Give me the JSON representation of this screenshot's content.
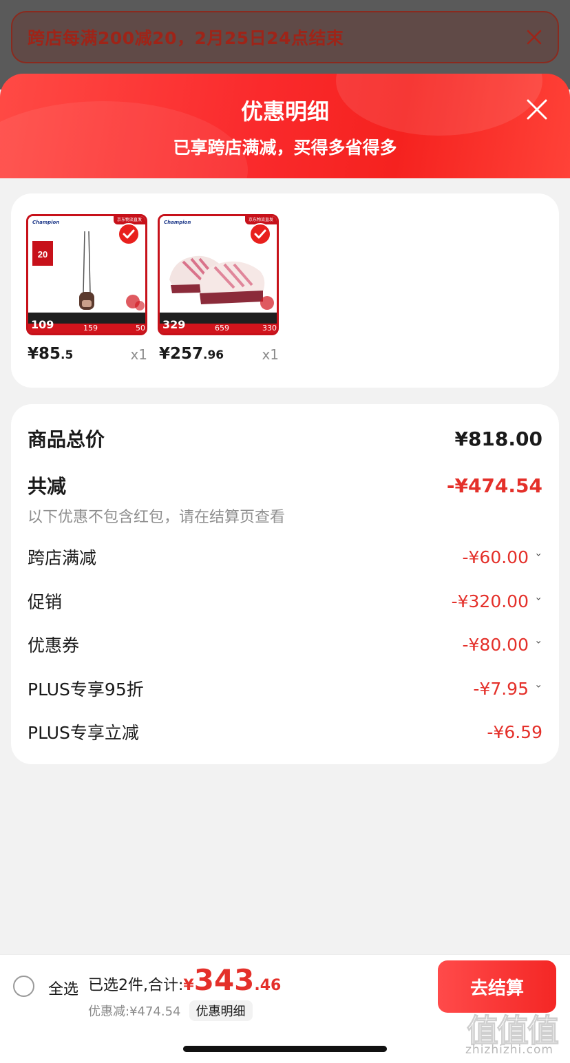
{
  "promo": {
    "text": "跨店每满200减20，2月25日24点结束"
  },
  "sheet": {
    "title": "优惠明细",
    "subtitle": "已享跨店满减，买得多省得多"
  },
  "products": [
    {
      "brand": "Champion",
      "ship_tag": "京东物流直发",
      "promo_price": "109",
      "sub_a": "159",
      "sub_b": "50",
      "price_int": "¥85",
      "price_dec": ".5",
      "qty": "x1"
    },
    {
      "brand": "Champion",
      "ship_tag": "京东物流直发",
      "promo_price": "329",
      "sub_a": "659",
      "sub_b": "330",
      "price_int": "¥257",
      "price_dec": ".96",
      "qty": "x1"
    }
  ],
  "summary": {
    "total_label": "商品总价",
    "total_value": "¥818.00",
    "reduce_label": "共减",
    "reduce_value": "-¥474.54",
    "note": "以下优惠不包含红包，请在结算页查看",
    "items": [
      {
        "label": "跨店满减",
        "value": "-¥60.00",
        "chevron": "›"
      },
      {
        "label": "促销",
        "value": "-¥320.00",
        "chevron": "›"
      },
      {
        "label": "优惠券",
        "value": "-¥80.00",
        "chevron": "›"
      },
      {
        "label": "PLUS专享95折",
        "value": "-¥7.95",
        "chevron": "›"
      },
      {
        "label": "PLUS专享立减",
        "value": "-¥6.59",
        "chevron": ""
      }
    ]
  },
  "bottom": {
    "select_all": "全选",
    "selected_prefix": "已选2件,合计:",
    "total_yen": "¥",
    "total_int": "343",
    "total_dec": ".46",
    "discount_text": "优惠减:¥474.54",
    "detail_chip": "优惠明细",
    "checkout": "去结算"
  },
  "watermark": {
    "big": "值值值",
    "small": "zhizhizhi.com"
  },
  "colors": {
    "accent": "#e4302a",
    "header_red": "#fa2a2c"
  }
}
